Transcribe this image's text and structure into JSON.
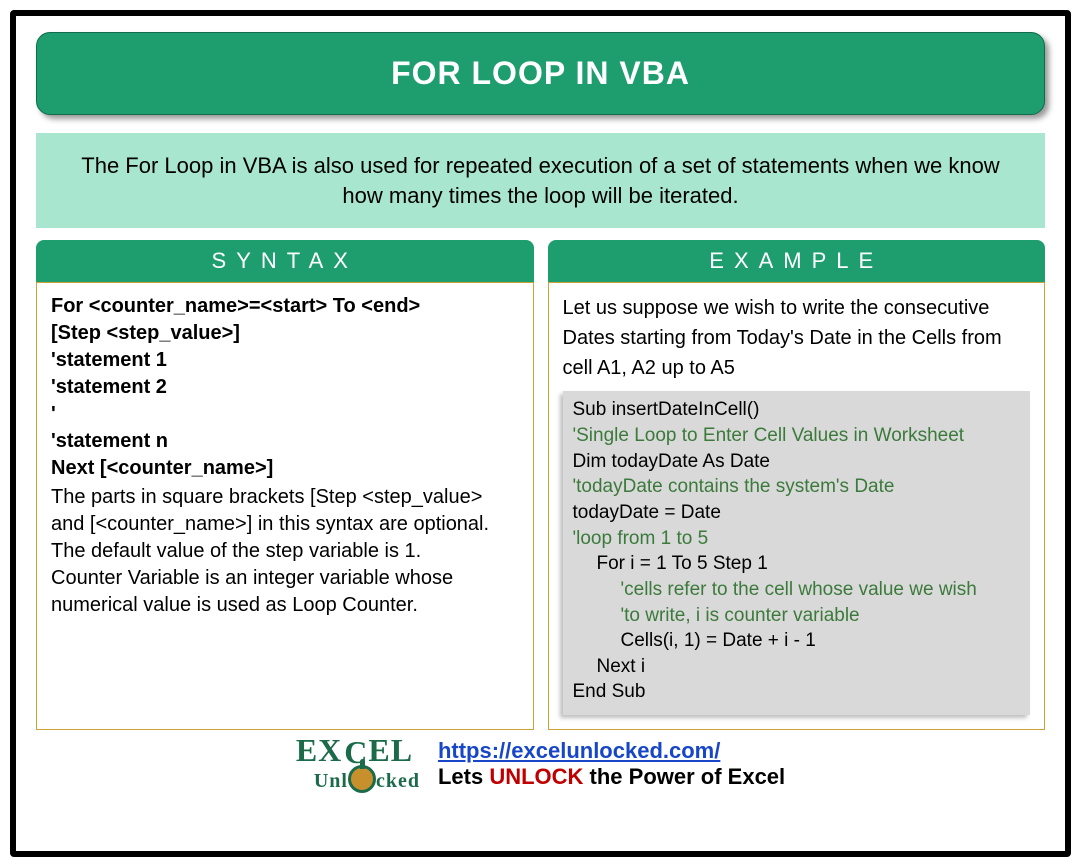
{
  "title": "FOR LOOP IN VBA",
  "description": "The For Loop in VBA is also used for repeated execution of a set of statements when we know how many times the loop will be iterated.",
  "columns": {
    "syntax": {
      "header": "SYNTAX",
      "lines": [
        "For <counter_name>=<start> To <end>",
        "[Step <step_value>]",
        "'statement 1",
        "'statement 2",
        "'",
        "'statement n",
        "Next [<counter_name>]"
      ],
      "notes": [
        "The parts in square brackets [Step <step_value> and [<counter_name>] in this syntax are optional.",
        "The default value of the step variable is 1.",
        "Counter Variable is an integer variable whose numerical value is used as Loop Counter."
      ]
    },
    "example": {
      "header": "EXAMPLE",
      "description": "Let us suppose we wish to write the consecutive Dates starting from Today's Date in the Cells from cell A1, A2 up to A5",
      "code": [
        {
          "text": "Sub insertDateInCell()",
          "indent": 0,
          "comment": false
        },
        {
          "text": "'Single Loop to Enter Cell Values in Worksheet",
          "indent": 0,
          "comment": true
        },
        {
          "text": "Dim todayDate As Date",
          "indent": 0,
          "comment": false
        },
        {
          "text": "'todayDate contains the system's Date",
          "indent": 0,
          "comment": true
        },
        {
          "text": "todayDate = Date",
          "indent": 0,
          "comment": false
        },
        {
          "text": "'loop from 1 to 5",
          "indent": 0,
          "comment": true
        },
        {
          "text": "For i = 1 To 5 Step 1",
          "indent": 1,
          "comment": false
        },
        {
          "text": "'cells refer to the cell whose value we wish",
          "indent": 2,
          "comment": true
        },
        {
          "text": "'to write, i is counter variable",
          "indent": 2,
          "comment": true
        },
        {
          "text": "Cells(i, 1) = Date + i - 1",
          "indent": 2,
          "comment": false
        },
        {
          "text": "Next i",
          "indent": 1,
          "comment": false
        },
        {
          "text": "End Sub",
          "indent": 0,
          "comment": false
        }
      ]
    }
  },
  "footer": {
    "logo_top_before": "EX",
    "logo_top_after": "EL",
    "logo_bottom_before": "Unl",
    "logo_bottom_after": "cked",
    "link": "https://excelunlocked.com/",
    "tagline_before": "Lets ",
    "tagline_unlock": "UNLOCK",
    "tagline_after": " the Power of Excel"
  }
}
